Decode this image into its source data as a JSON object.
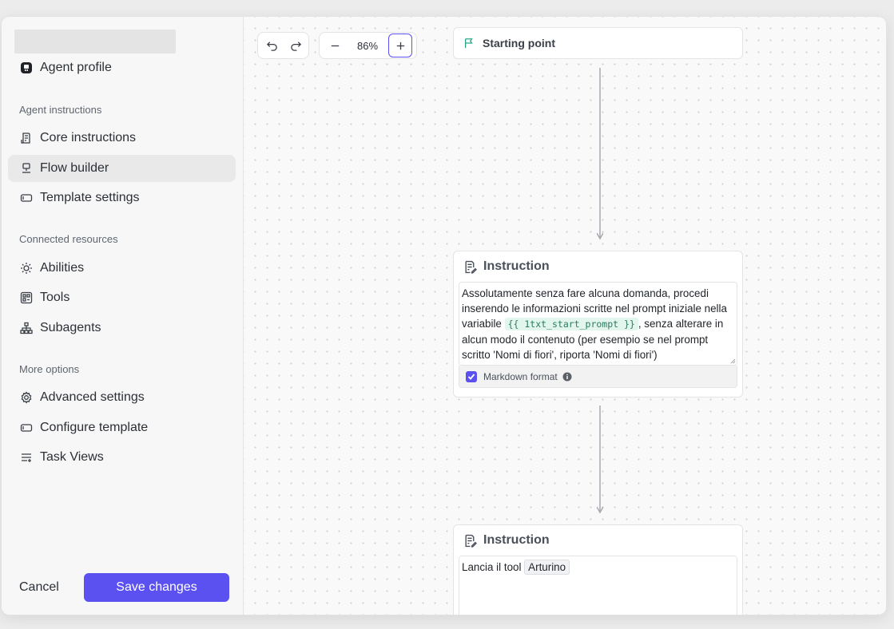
{
  "sidebar": {
    "agent_profile": {
      "label": "Agent profile",
      "icon": "agent-icon"
    },
    "sections": {
      "agent_instructions": "Agent instructions",
      "connected_resources": "Connected resources",
      "more_options": "More options"
    },
    "items": {
      "core_instructions": {
        "label": "Core instructions",
        "icon": "document-icon"
      },
      "flow_builder": {
        "label": "Flow builder",
        "icon": "flow-icon",
        "active": true
      },
      "template_settings": {
        "label": "Template settings",
        "icon": "template-icon"
      },
      "abilities": {
        "label": "Abilities",
        "icon": "sun-icon"
      },
      "tools": {
        "label": "Tools",
        "icon": "tools-icon"
      },
      "subagents": {
        "label": "Subagents",
        "icon": "hierarchy-icon"
      },
      "advanced_settings": {
        "label": "Advanced settings",
        "icon": "gear-icon"
      },
      "configure_template": {
        "label": "Configure template",
        "icon": "template-icon"
      },
      "task_views": {
        "label": "Task Views",
        "icon": "list-icon"
      }
    },
    "footer": {
      "cancel_label": "Cancel",
      "save_label": "Save changes"
    }
  },
  "canvas": {
    "toolbar": {
      "zoom": "86%"
    },
    "nodes": {
      "start": {
        "label": "Starting point",
        "icon": "flag-icon"
      },
      "instruction1": {
        "title": "Instruction",
        "text_a": "Assolutamente senza fare alcuna domanda, procedi inserendo le informazioni scritte nel prompt iniziale nella variabile ",
        "variable": "{{ 1txt_start_prompt }}",
        "text_b": ", senza alterare in alcun modo il contenuto (per esempio se nel prompt scritto 'Nomi di fiori', riporta 'Nomi di fiori')",
        "markdown_label": "Markdown format",
        "markdown_checked": true
      },
      "instruction2": {
        "title": "Instruction",
        "text": "Lancia il tool ",
        "tool": "Arturino"
      }
    }
  },
  "colors": {
    "accent": "#5b50f0",
    "start_icon": "#2ba88a"
  }
}
